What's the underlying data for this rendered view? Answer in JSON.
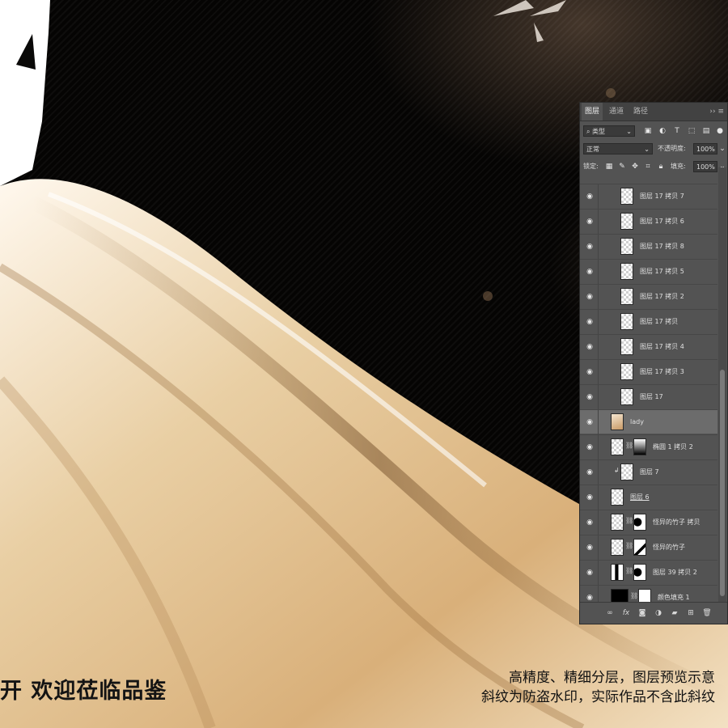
{
  "artwork": {
    "bottom_left_text": "开 欢迎莅临品鉴",
    "notice_line1": "高精度、精细分层，图层预览示意",
    "notice_line2": "斜纹为防盗水印，实际作品不含此斜纹"
  },
  "layers_panel": {
    "tabs": [
      "图层",
      "通道",
      "路径"
    ],
    "active_tab": "图层",
    "tab_menu_icon": "collapse-menu-icon",
    "filter": {
      "kind_label": "类型",
      "icons": [
        "image-filter-icon",
        "adjustment-filter-icon",
        "type-filter-icon",
        "shape-filter-icon",
        "smart-object-filter-icon"
      ]
    },
    "blend_mode": "正常",
    "opacity_label": "不透明度:",
    "opacity_value": "100%",
    "lock_label": "锁定:",
    "fill_label": "填充:",
    "fill_value": "100%",
    "layers": [
      {
        "name": "图层 17 拷贝 7",
        "visible": true
      },
      {
        "name": "图层 17 拷贝 6",
        "visible": true
      },
      {
        "name": "图层 17 拷贝 8",
        "visible": true
      },
      {
        "name": "图层 17 拷贝 5",
        "visible": true
      },
      {
        "name": "图层 17 拷贝 2",
        "visible": true
      },
      {
        "name": "图层 17 拷贝",
        "visible": true
      },
      {
        "name": "图层 17 拷贝 4",
        "visible": true
      },
      {
        "name": "图层 17 拷贝 3",
        "visible": true
      },
      {
        "name": "图层 17",
        "visible": true
      },
      {
        "name": "lady",
        "visible": true,
        "selected": true
      },
      {
        "name": "椭圆 1 拷贝 2",
        "visible": true,
        "has_mask": true
      },
      {
        "name": "图层 7",
        "visible": true,
        "clipped": true
      },
      {
        "name": "图层 6",
        "visible": true
      },
      {
        "name": "怪异的竹子 拷贝",
        "visible": true,
        "has_mask": true
      },
      {
        "name": "怪异的竹子",
        "visible": true,
        "has_mask": true
      },
      {
        "name": "图层 39 拷贝 2",
        "visible": true,
        "has_mask": true
      },
      {
        "name": "颜色填充 1",
        "visible": true,
        "has_mask": true
      }
    ],
    "bottom_icons": [
      "link-layers-icon",
      "fx-icon",
      "add-mask-icon",
      "adjustment-layer-icon",
      "new-group-icon",
      "new-layer-icon",
      "trash-icon"
    ]
  }
}
